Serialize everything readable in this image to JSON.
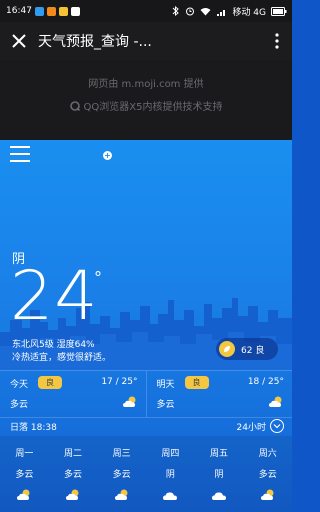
{
  "status_bar": {
    "time": "16:47",
    "network_label": "移动 4G",
    "app_icon_colors": [
      "#2f9cf0",
      "#f08a1c",
      "#f4c233",
      "#ffffff"
    ]
  },
  "toolbar": {
    "title": "天气预报_查询 -..."
  },
  "info": {
    "provided_by": "网页由 m.moji.com 提供",
    "powered_by": "QQ浏览器X5内核提供技术支持"
  },
  "weather": {
    "condition": "阴",
    "temperature": "24",
    "degree_symbol": "°",
    "wind_humidity": "东北风5级 湿度64%",
    "comfort": "冷热适宜，感觉很舒适。",
    "aqi": "62 良",
    "today": {
      "name": "今天",
      "badge": "良",
      "range": "17 / 25°",
      "condition": "多云",
      "icon": "partly-cloudy"
    },
    "tomorrow": {
      "name": "明天",
      "badge": "良",
      "range": "18 / 25°",
      "condition": "多云",
      "icon": "partly-cloudy"
    },
    "sunset": "日落 18:38",
    "hours_label": "24小时",
    "forecast": [
      {
        "day": "周一",
        "condition": "多云",
        "icon": "partly-cloudy"
      },
      {
        "day": "周二",
        "condition": "多云",
        "icon": "partly-cloudy"
      },
      {
        "day": "周三",
        "condition": "多云",
        "icon": "partly-cloudy"
      },
      {
        "day": "周四",
        "condition": "阴",
        "icon": "cloudy"
      },
      {
        "day": "周五",
        "condition": "阴",
        "icon": "cloudy"
      },
      {
        "day": "周六",
        "condition": "多云",
        "icon": "partly-cloudy"
      }
    ]
  },
  "colors": {
    "sky_top": "#1a8ff0",
    "sky_bottom": "#1460d2",
    "badge_yellow": "#f3c742",
    "dark_bar": "#1c1c1f"
  }
}
